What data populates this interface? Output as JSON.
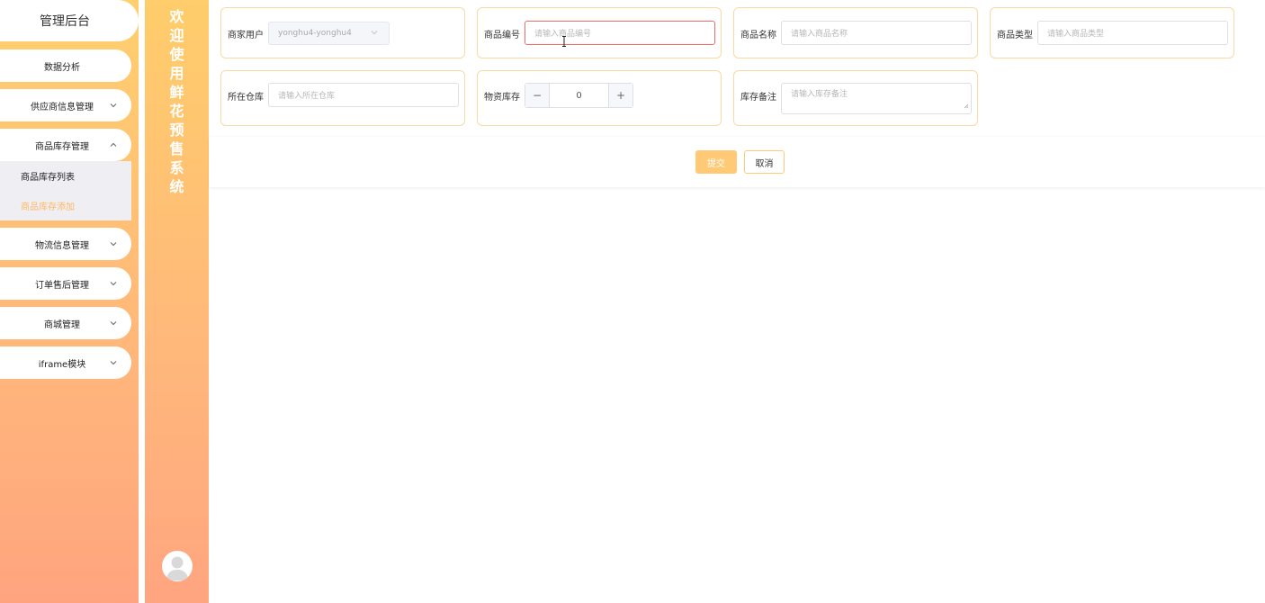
{
  "sidebar": {
    "title": "管理后台",
    "menu": [
      {
        "label": "数据分析"
      },
      {
        "label": "供应商信息管理"
      },
      {
        "label": "商品库存管理",
        "children": [
          "商品库存列表",
          "商品库存添加"
        ]
      },
      {
        "label": "物流信息管理"
      },
      {
        "label": "订单售后管理"
      },
      {
        "label": "商城管理"
      },
      {
        "label": "iframe模块"
      }
    ]
  },
  "welcome": [
    "欢",
    "迎",
    "使",
    "用",
    "鲜",
    "花",
    "预",
    "售",
    "系",
    "统"
  ],
  "form": {
    "merchant_user": {
      "label": "商家用户",
      "value": "yonghu4-yonghu4"
    },
    "product_code": {
      "label": "商品编号",
      "placeholder": "请输入商品编号"
    },
    "product_name": {
      "label": "商品名称",
      "placeholder": "请输入商品名称"
    },
    "product_type": {
      "label": "商品类型",
      "placeholder": "请输入商品类型"
    },
    "warehouse": {
      "label": "所在仓库",
      "placeholder": "请输入所在仓库"
    },
    "stock": {
      "label": "物资库存",
      "value": "0",
      "minus": "−",
      "plus": "+"
    },
    "stock_note": {
      "label": "库存备注",
      "placeholder": "请输入库存备注"
    }
  },
  "buttons": {
    "submit": "提交",
    "cancel": "取消"
  },
  "colors": {
    "accent": "#ffc976",
    "sidebar_gradient_top": "#ffcf6e",
    "sidebar_gradient_bottom": "#ffa47f",
    "focus_border": "#f06a6a"
  }
}
